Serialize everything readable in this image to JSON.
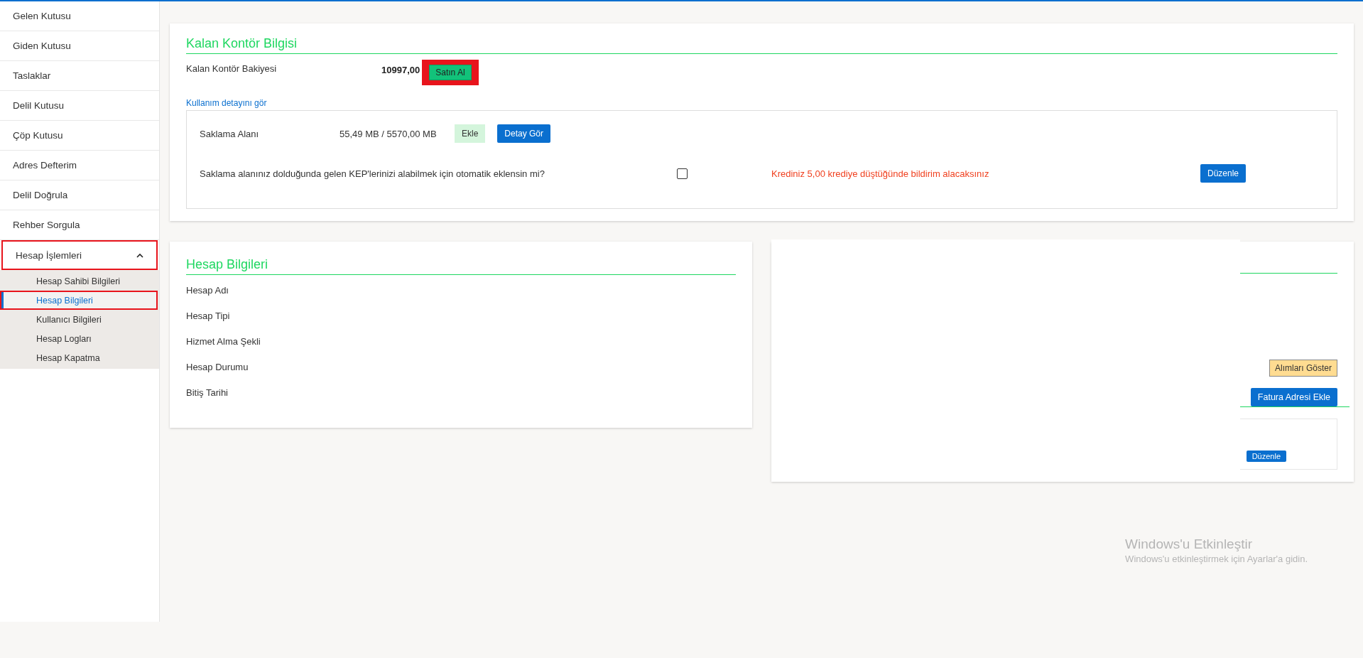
{
  "sidebar": {
    "items": [
      {
        "label": "Gelen Kutusu",
        "selected": false,
        "highlighted": false
      },
      {
        "label": "Giden Kutusu",
        "selected": false,
        "highlighted": false
      },
      {
        "label": "Taslaklar",
        "selected": false,
        "highlighted": false
      },
      {
        "label": "Delil Kutusu",
        "selected": false,
        "highlighted": false
      },
      {
        "label": "Çöp Kutusu",
        "selected": false,
        "highlighted": false
      },
      {
        "label": "Adres Defterim",
        "selected": false,
        "highlighted": false
      },
      {
        "label": "Delil Doğrula",
        "selected": false,
        "highlighted": false
      },
      {
        "label": "Rehber Sorgula",
        "selected": false,
        "highlighted": false
      },
      {
        "label": "Hesap İşlemleri",
        "selected": false,
        "highlighted": true,
        "expanded": true,
        "children": [
          {
            "label": "Hesap Sahibi Bilgileri",
            "selected": false,
            "highlighted": false
          },
          {
            "label": "Hesap Bilgileri",
            "selected": true,
            "highlighted": true
          },
          {
            "label": "Kullanıcı Bilgileri",
            "selected": false,
            "highlighted": false
          },
          {
            "label": "Hesap Logları",
            "selected": false,
            "highlighted": false
          },
          {
            "label": "Hesap Kapatma",
            "selected": false,
            "highlighted": false
          }
        ]
      }
    ]
  },
  "credit_card": {
    "title": "Kalan Kontör Bilgisi",
    "balance_label": "Kalan Kontör Bakiyesi",
    "balance_value": "10997,00",
    "buy_button": {
      "label": "Satın Al",
      "highlighted": true
    },
    "usage_link": "Kullanım detayını gör",
    "storage": {
      "label": "Saklama Alanı",
      "value": "55,49 MB / 5570,00 MB",
      "add_button": "Ekle",
      "detail_button": "Detay Gör"
    },
    "auto_add": {
      "question": "Saklama alanınız dolduğunda gelen KEP'lerinizi alabilmek için otomatik eklensin mi?",
      "checked": false
    },
    "notice": "Krediniz 5,00 krediye düştüğünde bildirim alacaksınız",
    "edit_button": "Düzenle"
  },
  "account_card": {
    "title": "Hesap Bilgileri",
    "fields": [
      "Hesap Adı",
      "Hesap Tipi",
      "Hizmet Alma Şekli",
      "Hesap Durumu",
      "Bitiş Tarihi"
    ]
  },
  "billing_card": {
    "purchases_button": "Alımları Göster",
    "add_address_button": "Fatura Adresi Ekle",
    "edit_button": "Düzenle"
  },
  "os_notice": {
    "title": "Windows'u Etkinleştir",
    "subtitle": "Windows'u etkinleştirmek için Ayarlar'a gidin."
  }
}
